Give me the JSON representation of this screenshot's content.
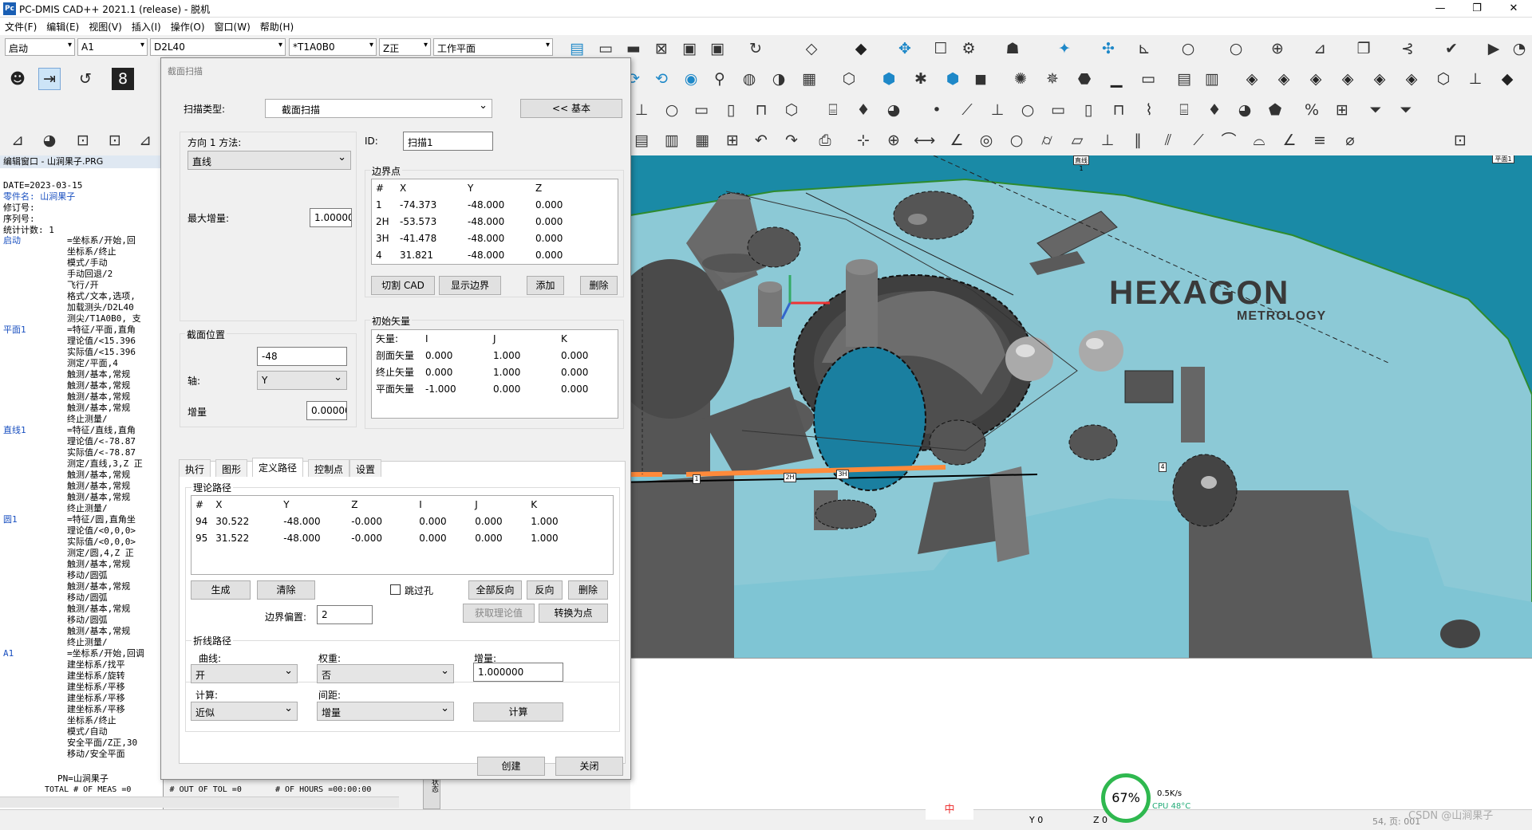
{
  "app": {
    "logo": "Pc",
    "title": "PC-DMIS CAD++ 2021.1 (release) - 脱机"
  },
  "window_controls": {
    "minimize": "—",
    "maximize": "❐",
    "close": "✕"
  },
  "menu": [
    "文件(F)",
    "编辑(E)",
    "视图(V)",
    "插入(I)",
    "操作(O)",
    "窗口(W)",
    "帮助(H)"
  ],
  "combos": {
    "mode": "启动",
    "alignment": "A1",
    "probe": "D2L40",
    "tip": "*T1A0B0",
    "view": "Z正",
    "plane": "工作平面"
  },
  "edit_window": {
    "header": "编辑窗口 - 山涧果子.PRG",
    "lines": [
      "DATE=2023-03-15",
      "零件名: 山涧果子",
      "修订号:",
      "序列号:",
      "统计计数: 1"
    ],
    "program": [
      [
        "启动",
        "=坐标系/开始,回"
      ],
      [
        "",
        "坐标系/终止"
      ],
      [
        "",
        "模式/手动"
      ],
      [
        "",
        "手动回退/2"
      ],
      [
        "",
        "飞行/开"
      ],
      [
        "",
        "格式/文本,选项,"
      ],
      [
        "",
        "加载测头/D2L40"
      ],
      [
        "",
        "测尖/T1A0B0, 支"
      ],
      [
        "平面1",
        "=特征/平面,直角"
      ],
      [
        "",
        "理论值/<15.396"
      ],
      [
        "",
        "实际值/<15.396"
      ],
      [
        "",
        "测定/平面,4"
      ],
      [
        "",
        "触测/基本,常规"
      ],
      [
        "",
        "触测/基本,常规"
      ],
      [
        "",
        "触测/基本,常规"
      ],
      [
        "",
        "触测/基本,常规"
      ],
      [
        "",
        "终止测量/"
      ],
      [
        "直线1",
        "=特征/直线,直角"
      ],
      [
        "",
        "理论值/<-78.87"
      ],
      [
        "",
        "实际值/<-78.87"
      ],
      [
        "",
        "测定/直线,3,Z 正"
      ],
      [
        "",
        "触测/基本,常规"
      ],
      [
        "",
        "触测/基本,常规"
      ],
      [
        "",
        "触测/基本,常规"
      ],
      [
        "",
        "终止测量/"
      ],
      [
        "圆1",
        "=特征/圆,直角坐"
      ],
      [
        "",
        "理论值/<0,0,0>"
      ],
      [
        "",
        "实际值/<0,0,0>"
      ],
      [
        "",
        "测定/圆,4,Z 正"
      ],
      [
        "",
        "触测/基本,常规"
      ],
      [
        "",
        "移动/圆弧"
      ],
      [
        "",
        "触测/基本,常规"
      ],
      [
        "",
        "移动/圆弧"
      ],
      [
        "",
        "触测/基本,常规"
      ],
      [
        "",
        "移动/圆弧"
      ],
      [
        "",
        "触测/基本,常规"
      ],
      [
        "",
        "终止测量/"
      ],
      [
        "A1",
        "=坐标系/开始,回调"
      ],
      [
        "",
        "建坐标系/找平"
      ],
      [
        "",
        "建坐标系/旋转"
      ],
      [
        "",
        "建坐标系/平移"
      ],
      [
        "",
        "建坐标系/平移"
      ],
      [
        "",
        "建坐标系/平移"
      ],
      [
        "",
        "坐标系/终止"
      ],
      [
        "",
        "模式/自动"
      ],
      [
        "",
        "安全平面/Z正,30"
      ],
      [
        "",
        "移动/安全平面"
      ]
    ],
    "footer1": "PN=山涧果子",
    "footer2": "TOTAL # OF MEAS =0        # OUT OF TOL =0       # OF HOURS =00:00:00"
  },
  "dialog": {
    "title": "截面扫描",
    "scan_type_label": "扫描类型:",
    "scan_type": "截面扫描",
    "basic_button": "<< 基本",
    "direction_label": "方向 1 方法:",
    "direction_value": "直线",
    "max_inc_label": "最大增量:",
    "max_inc_value": "1.00000",
    "id_label": "ID:",
    "id_value": "扫描1",
    "boundary": {
      "title": "边界点",
      "headers": [
        "#",
        "X",
        "Y",
        "Z"
      ],
      "rows": [
        [
          "1",
          "-74.373",
          "-48.000",
          "0.000"
        ],
        [
          "2H",
          "-53.573",
          "-48.000",
          "0.000"
        ],
        [
          "3H",
          "-41.478",
          "-48.000",
          "0.000"
        ],
        [
          "4",
          "31.821",
          "-48.000",
          "0.000"
        ]
      ],
      "buttons": [
        "切割 CAD",
        "显示边界",
        "添加",
        "删除"
      ]
    },
    "section": {
      "title": "截面位置",
      "value": "-48",
      "axis_label": "轴:",
      "axis_value": "Y",
      "inc_label": "增量",
      "inc_value": "0.00000"
    },
    "initial_vector": {
      "title": "初始矢量",
      "headers": [
        "矢量:",
        "I",
        "J",
        "K"
      ],
      "rows": [
        [
          "剖面矢量",
          "0.000",
          "1.000",
          "0.000"
        ],
        [
          "终止矢量",
          "0.000",
          "1.000",
          "0.000"
        ],
        [
          "平面矢量",
          "-1.000",
          "0.000",
          "0.000"
        ]
      ]
    },
    "tabs": [
      "执行",
      "图形",
      "定义路径",
      "控制点",
      "设置"
    ],
    "path": {
      "title": "理论路径",
      "headers": [
        "#",
        "X",
        "Y",
        "Z",
        "I",
        "J",
        "K"
      ],
      "rows": [
        [
          "94",
          "30.522",
          "-48.000",
          "-0.000",
          "0.000",
          "0.000",
          "1.000"
        ],
        [
          "95",
          "31.522",
          "-48.000",
          "-0.000",
          "0.000",
          "0.000",
          "1.000"
        ]
      ],
      "gen": "生成",
      "clear": "清除",
      "skip_hole": "跳过孔",
      "reverse_all": "全部反向",
      "reverse": "反向",
      "delete": "删除",
      "get_theory": "获取理论值",
      "to_point": "转换为点",
      "offset_label": "边界偏置:",
      "offset_value": "2"
    },
    "polyline": {
      "title": "折线路径",
      "curve_label": "曲线:",
      "curve_value": "开",
      "weight_label": "权重:",
      "weight_value": "否",
      "inc_label": "增量:",
      "inc_value": "1.000000",
      "calc_label": "计算:",
      "calc_value": "近似",
      "spacing_label": "间距:",
      "spacing_value": "增量",
      "calc_button": "计算"
    },
    "create": "创建",
    "close": "关闭"
  },
  "viewport": {
    "brand": "HEXAGON",
    "brand_sub": "METROLOGY",
    "plane_label": "平面1",
    "line_label": "直线1",
    "points": [
      "1",
      "2H",
      "3H",
      "4"
    ]
  },
  "status": {
    "cpu_pct": "67%",
    "speed": "0.5K/s",
    "cpu": "CPU 48°C",
    "y": "Y 0",
    "z": "Z 0",
    "right": "CSDN @山涧果子",
    "sat": "54, 页: 001",
    "ime": "中"
  },
  "colors": {
    "viewport": "#1a8aa6",
    "part": "#5a5a5a",
    "plate": "#7ec8d8",
    "accent": "#1e88c8"
  }
}
